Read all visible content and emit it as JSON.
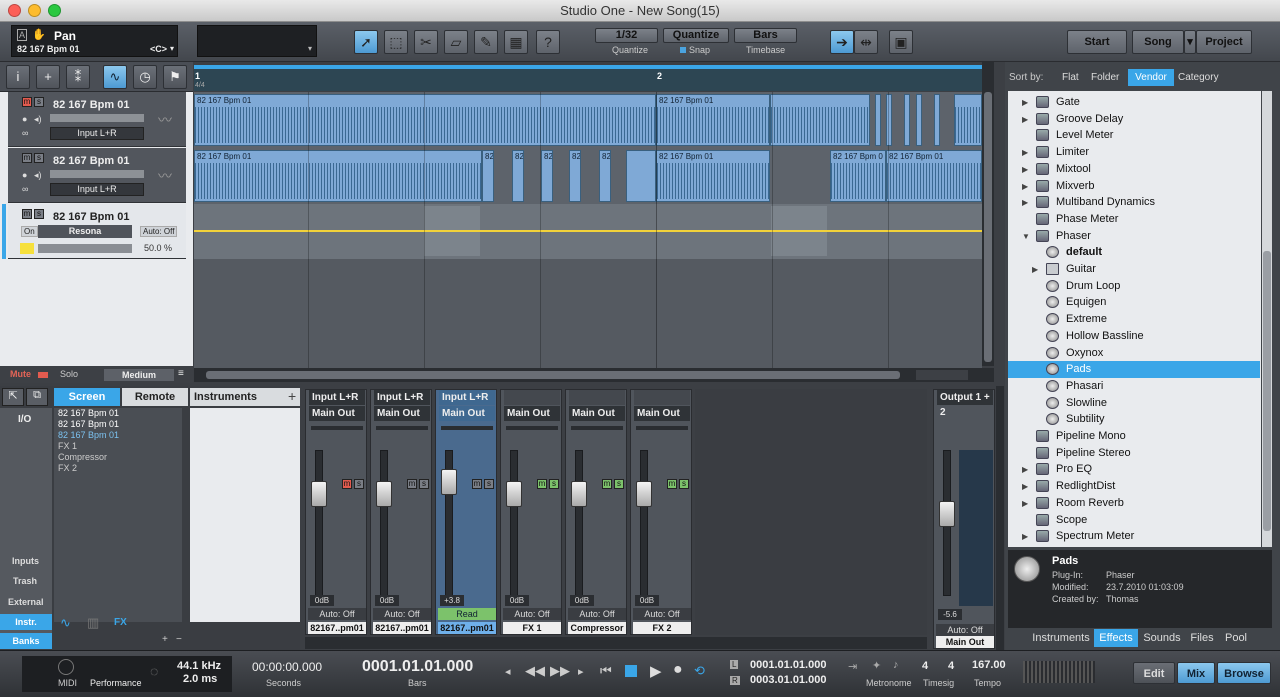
{
  "window": {
    "title": "Studio One - New Song(15)"
  },
  "toolbar": {
    "track_name": "Pan",
    "track_sub": "82 167 Bpm 01",
    "track_key": "<C>",
    "quantize_value": "1/32",
    "quantize_label": "Quantize",
    "quantize_btn": "Quantize",
    "snap_label": "Snap",
    "timebase_value": "Bars",
    "timebase_label": "Timebase",
    "start_btn": "Start",
    "song_btn": "Song",
    "project_btn": "Project",
    "help_icon": "?"
  },
  "ruler": {
    "marker1": "1",
    "marker2": "2",
    "sig": "4/4"
  },
  "tracks": [
    {
      "name": "82 167 Bpm 01",
      "input": "Input L+R"
    },
    {
      "name": "82 167 Bpm 01",
      "input": "Input L+R"
    },
    {
      "name": "82 167 Bpm 01",
      "instrument": "Resona",
      "on": "On",
      "auto": "Auto: Off",
      "percent": "50.0 %"
    }
  ],
  "clips": {
    "c1": "82 167 Bpm 01",
    "c2": "82 167 Bpm 01",
    "c3": "82 167 Bpm 01",
    "c4": "82 167 Bpm 01",
    "c5": "82 167 Bpm 0",
    "c6": "82 167 Bpm 01",
    "s1": "82",
    "s2": "82",
    "s3": "82",
    "s4": "82",
    "s5": "82"
  },
  "track_footer": {
    "mute": "Mute",
    "solo": "Solo",
    "size": "Medium"
  },
  "mixer_nav": {
    "screen": "Screen",
    "remote": "Remote",
    "io": "I/O",
    "instruments": "Instruments",
    "list": [
      "82 167 Bpm 01",
      "82 167 Bpm 01",
      "82 167 Bpm 01",
      "FX 1",
      "Compressor",
      "FX 2"
    ],
    "inputs": "Inputs",
    "trash": "Trash",
    "external": "External",
    "instr": "Instr.",
    "banks": "Banks",
    "fx": "FX"
  },
  "channels": [
    {
      "in": "Input L+R",
      "out": "Main Out",
      "db": "0dB",
      "auto": "Auto: Off",
      "label": "82167..pm01"
    },
    {
      "in": "Input L+R",
      "out": "Main Out",
      "db": "0dB",
      "auto": "Auto: Off",
      "label": "82167..pm01"
    },
    {
      "in": "Input L+R",
      "out": "Main Out",
      "db": "+3.8",
      "auto": "Read",
      "label": "82167..pm01"
    },
    {
      "in": "",
      "out": "Main Out",
      "db": "0dB",
      "auto": "Auto: Off",
      "label": "FX 1"
    },
    {
      "in": "",
      "out": "Main Out",
      "db": "0dB",
      "auto": "Auto: Off",
      "label": "Compressor"
    },
    {
      "in": "",
      "out": "Main Out",
      "db": "0dB",
      "auto": "Auto: Off",
      "label": "FX 2"
    }
  ],
  "master": {
    "name": "Output 1 + 2",
    "db": "-5.6",
    "auto": "Auto: Off",
    "label": "Main Out"
  },
  "browser": {
    "sort_by": "Sort by:",
    "sort_tabs": [
      "Flat",
      "Folder",
      "Vendor",
      "Category"
    ],
    "items": [
      {
        "label": "Gate",
        "type": "plugin",
        "indent": 1,
        "arrow": "right"
      },
      {
        "label": "Groove Delay",
        "type": "plugin",
        "indent": 1,
        "arrow": "right"
      },
      {
        "label": "Level Meter",
        "type": "plugin",
        "indent": 1,
        "arrow": ""
      },
      {
        "label": "Limiter",
        "type": "plugin",
        "indent": 1,
        "arrow": "right"
      },
      {
        "label": "Mixtool",
        "type": "plugin",
        "indent": 1,
        "arrow": "right"
      },
      {
        "label": "Mixverb",
        "type": "plugin",
        "indent": 1,
        "arrow": "right"
      },
      {
        "label": "Multiband Dynamics",
        "type": "plugin",
        "indent": 1,
        "arrow": "right"
      },
      {
        "label": "Phase Meter",
        "type": "plugin",
        "indent": 1,
        "arrow": ""
      },
      {
        "label": "Phaser",
        "type": "plugin",
        "indent": 1,
        "arrow": "down"
      },
      {
        "label": "default",
        "type": "preset",
        "indent": 2,
        "arrow": "",
        "bold": true
      },
      {
        "label": "Guitar",
        "type": "folder",
        "indent": 2,
        "arrow": "right"
      },
      {
        "label": "Drum Loop",
        "type": "preset",
        "indent": 2,
        "arrow": ""
      },
      {
        "label": "Equigen",
        "type": "preset",
        "indent": 2,
        "arrow": ""
      },
      {
        "label": "Extreme",
        "type": "preset",
        "indent": 2,
        "arrow": ""
      },
      {
        "label": "Hollow Bassline",
        "type": "preset",
        "indent": 2,
        "arrow": ""
      },
      {
        "label": "Oxynox",
        "type": "preset",
        "indent": 2,
        "arrow": ""
      },
      {
        "label": "Pads",
        "type": "preset",
        "indent": 2,
        "arrow": "",
        "selected": true
      },
      {
        "label": "Phasari",
        "type": "preset",
        "indent": 2,
        "arrow": ""
      },
      {
        "label": "Slowline",
        "type": "preset",
        "indent": 2,
        "arrow": ""
      },
      {
        "label": "Subtility",
        "type": "preset",
        "indent": 2,
        "arrow": ""
      },
      {
        "label": "Pipeline Mono",
        "type": "plugin",
        "indent": 1,
        "arrow": ""
      },
      {
        "label": "Pipeline Stereo",
        "type": "plugin",
        "indent": 1,
        "arrow": ""
      },
      {
        "label": "Pro EQ",
        "type": "plugin",
        "indent": 1,
        "arrow": "right"
      },
      {
        "label": "RedlightDist",
        "type": "plugin",
        "indent": 1,
        "arrow": "right"
      },
      {
        "label": "Room Reverb",
        "type": "plugin",
        "indent": 1,
        "arrow": "right"
      },
      {
        "label": "Scope",
        "type": "plugin",
        "indent": 1,
        "arrow": ""
      },
      {
        "label": "Spectrum Meter",
        "type": "plugin",
        "indent": 1,
        "arrow": "right"
      }
    ],
    "info": {
      "title": "Pads",
      "plugin_label": "Plug-In:",
      "plugin_value": "Phaser",
      "modified_label": "Modified:",
      "modified_value": "23.7.2010 01:03:09",
      "created_label": "Created by:",
      "created_value": "Thomas"
    },
    "tabs": [
      "Instruments",
      "Effects",
      "Sounds",
      "Files",
      "Pool"
    ]
  },
  "transport": {
    "midi": "MIDI",
    "performance": "Performance",
    "sample_rate": "44.1 kHz",
    "latency": "2.0 ms",
    "time": "00:00:00.000",
    "seconds": "Seconds",
    "bars_pos": "0001.01.01.000",
    "bars": "Bars",
    "loop_start": "0001.01.01.000",
    "loop_end": "0003.01.01.000",
    "metronome": "Metronome",
    "sig_num": "4",
    "sig_den": "4",
    "timesig": "Timesig",
    "tempo_value": "167.00",
    "tempo": "Tempo",
    "edit": "Edit",
    "mix": "Mix",
    "browse": "Browse"
  }
}
